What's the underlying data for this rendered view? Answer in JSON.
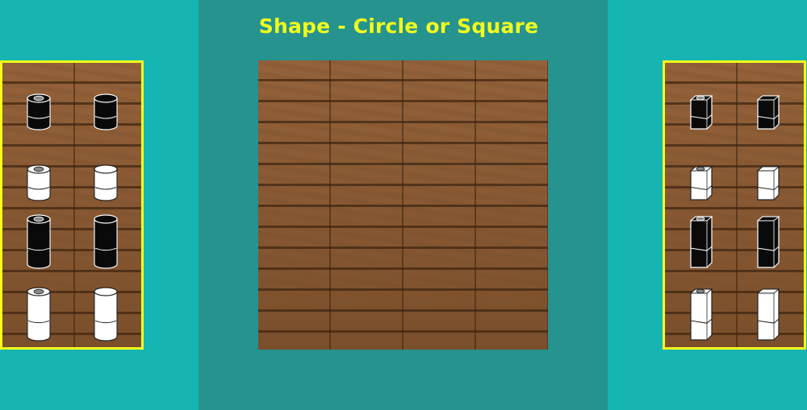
{
  "title": "Shape - Circle or Square",
  "colors": {
    "background": "#17b5b1",
    "center_panel": "#26938f",
    "title": "#f1ff1e",
    "tray_border": "#f5ff1a",
    "wood": "#8a5a32"
  },
  "left_tray": {
    "pieces": [
      {
        "name": "black-short-round-hollow",
        "color": "black",
        "height": "short",
        "shape": "round",
        "top": "hollow"
      },
      {
        "name": "black-short-round-solid",
        "color": "black",
        "height": "short",
        "shape": "round",
        "top": "solid"
      },
      {
        "name": "white-short-round-hollow",
        "color": "white",
        "height": "short",
        "shape": "round",
        "top": "hollow"
      },
      {
        "name": "white-short-round-solid",
        "color": "white",
        "height": "short",
        "shape": "round",
        "top": "solid"
      },
      {
        "name": "black-tall-round-hollow",
        "color": "black",
        "height": "tall",
        "shape": "round",
        "top": "hollow"
      },
      {
        "name": "black-tall-round-solid",
        "color": "black",
        "height": "tall",
        "shape": "round",
        "top": "solid"
      },
      {
        "name": "white-tall-round-hollow",
        "color": "white",
        "height": "tall",
        "shape": "round",
        "top": "hollow"
      },
      {
        "name": "white-tall-round-solid",
        "color": "white",
        "height": "tall",
        "shape": "round",
        "top": "solid"
      }
    ]
  },
  "right_tray": {
    "pieces": [
      {
        "name": "black-short-square-hollow",
        "color": "black",
        "height": "short",
        "shape": "square",
        "top": "hollow"
      },
      {
        "name": "black-short-square-solid",
        "color": "black",
        "height": "short",
        "shape": "square",
        "top": "solid"
      },
      {
        "name": "white-short-square-hollow",
        "color": "white",
        "height": "short",
        "shape": "square",
        "top": "hollow"
      },
      {
        "name": "white-short-square-solid",
        "color": "white",
        "height": "short",
        "shape": "square",
        "top": "solid"
      },
      {
        "name": "black-tall-square-hollow",
        "color": "black",
        "height": "tall",
        "shape": "square",
        "top": "hollow"
      },
      {
        "name": "black-tall-square-solid",
        "color": "black",
        "height": "tall",
        "shape": "square",
        "top": "solid"
      },
      {
        "name": "white-tall-square-hollow",
        "color": "white",
        "height": "tall",
        "shape": "square",
        "top": "hollow"
      },
      {
        "name": "white-tall-square-solid",
        "color": "white",
        "height": "tall",
        "shape": "square",
        "top": "solid"
      }
    ]
  },
  "board": {
    "cells_filled": 0
  }
}
